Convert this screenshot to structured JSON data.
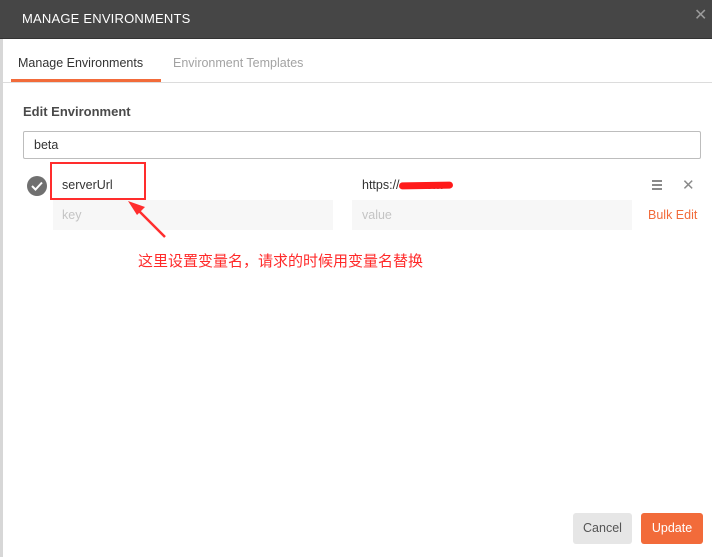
{
  "dialog": {
    "title": "MANAGE ENVIRONMENTS",
    "close_icon": "close-icon"
  },
  "tabs": [
    {
      "label": "Manage Environments",
      "active": true
    },
    {
      "label": "Environment Templates",
      "active": false
    }
  ],
  "edit": {
    "section_title": "Edit Environment",
    "env_name_value": "beta"
  },
  "variables": [
    {
      "enabled": true,
      "key": "serverUrl",
      "value": "https://••••••om"
    }
  ],
  "new_row": {
    "key_placeholder": "key",
    "value_placeholder": "value",
    "bulk_edit_label": "Bulk Edit"
  },
  "annotation": {
    "text": "这里设置变量名，请求的时候用变量名替换",
    "color": "#ff2a2a"
  },
  "footer": {
    "cancel_label": "Cancel",
    "update_label": "Update"
  },
  "colors": {
    "accent": "#f26b3a",
    "titlebar": "#464646"
  }
}
